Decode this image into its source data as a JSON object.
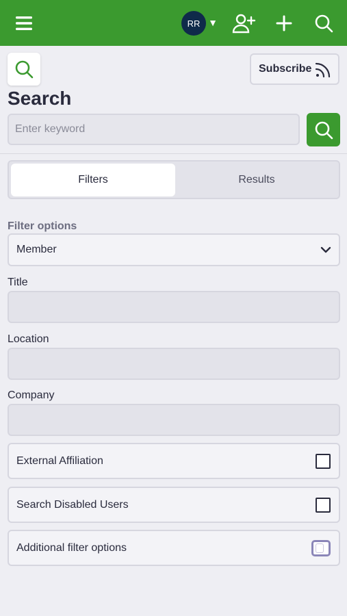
{
  "header": {
    "avatar_initials": "RR",
    "avatar_caret": "▼",
    "icons": [
      "hamburger-menu-icon",
      "add-user-icon",
      "plus-icon",
      "search-icon"
    ]
  },
  "toolbar": {
    "subscribe_label": "Subscribe"
  },
  "page": {
    "title": "Search"
  },
  "search": {
    "placeholder": "Enter keyword",
    "value": ""
  },
  "tabs": [
    {
      "label": "Filters",
      "active": true
    },
    {
      "label": "Results",
      "active": false
    }
  ],
  "filters": {
    "options_label": "Filter options",
    "selected_option": "Member",
    "title_label": "Title",
    "title_value": "",
    "location_label": "Location",
    "location_value": "",
    "company_label": "Company",
    "company_value": "",
    "external_affiliation_label": "External Affiliation",
    "external_affiliation_checked": false,
    "disabled_users_label": "Search Disabled Users",
    "disabled_users_checked": false,
    "additional_options_label": "Additional filter options",
    "additional_options_checked": false
  },
  "colors": {
    "brand_green": "#3b9a2f",
    "avatar_navy": "#0f2a4a",
    "background": "#eeeef3"
  }
}
